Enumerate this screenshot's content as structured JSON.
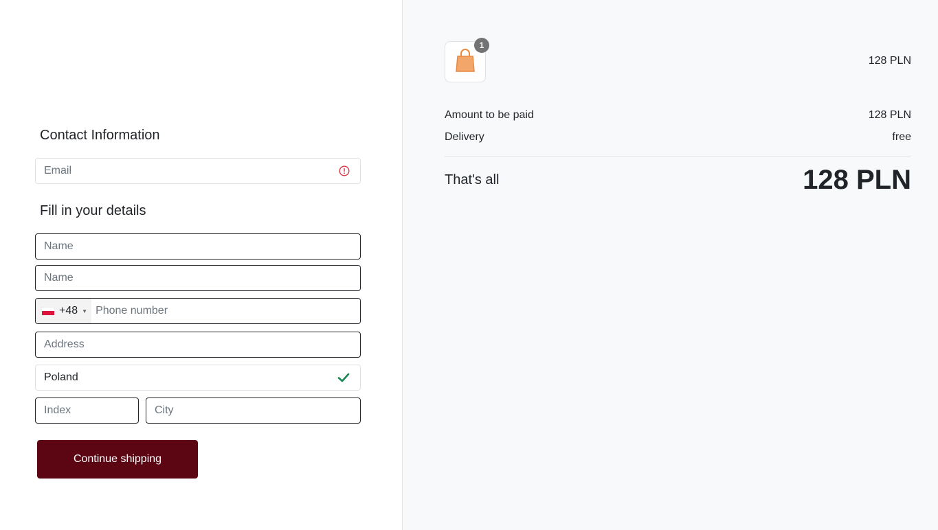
{
  "contact": {
    "heading": "Contact Information",
    "email_placeholder": "Email",
    "email_status_icon": "alert-circle-icon",
    "email_status_color": "#dc3545"
  },
  "details": {
    "heading": "Fill in your details",
    "first_name_placeholder": "Name",
    "last_name_placeholder": "Name",
    "phone": {
      "country_flag": "poland-flag-icon",
      "dial_code": "+48",
      "placeholder": "Phone number"
    },
    "address_placeholder": "Address",
    "country_value": "Poland",
    "country_status_icon": "checkmark-icon",
    "country_status_color": "#198754",
    "index_placeholder": "Index",
    "city_placeholder": "City"
  },
  "actions": {
    "continue_label": "Continue shipping",
    "continue_color": "#5c0613"
  },
  "summary": {
    "cart_item": {
      "icon": "shopping-bag-icon",
      "quantity": "1",
      "price": "128 PLN"
    },
    "amount_label": "Amount to be paid",
    "amount_value": "128 PLN",
    "delivery_label": "Delivery",
    "delivery_value": "free",
    "total_label": "That's all",
    "total_value": "128 PLN"
  }
}
